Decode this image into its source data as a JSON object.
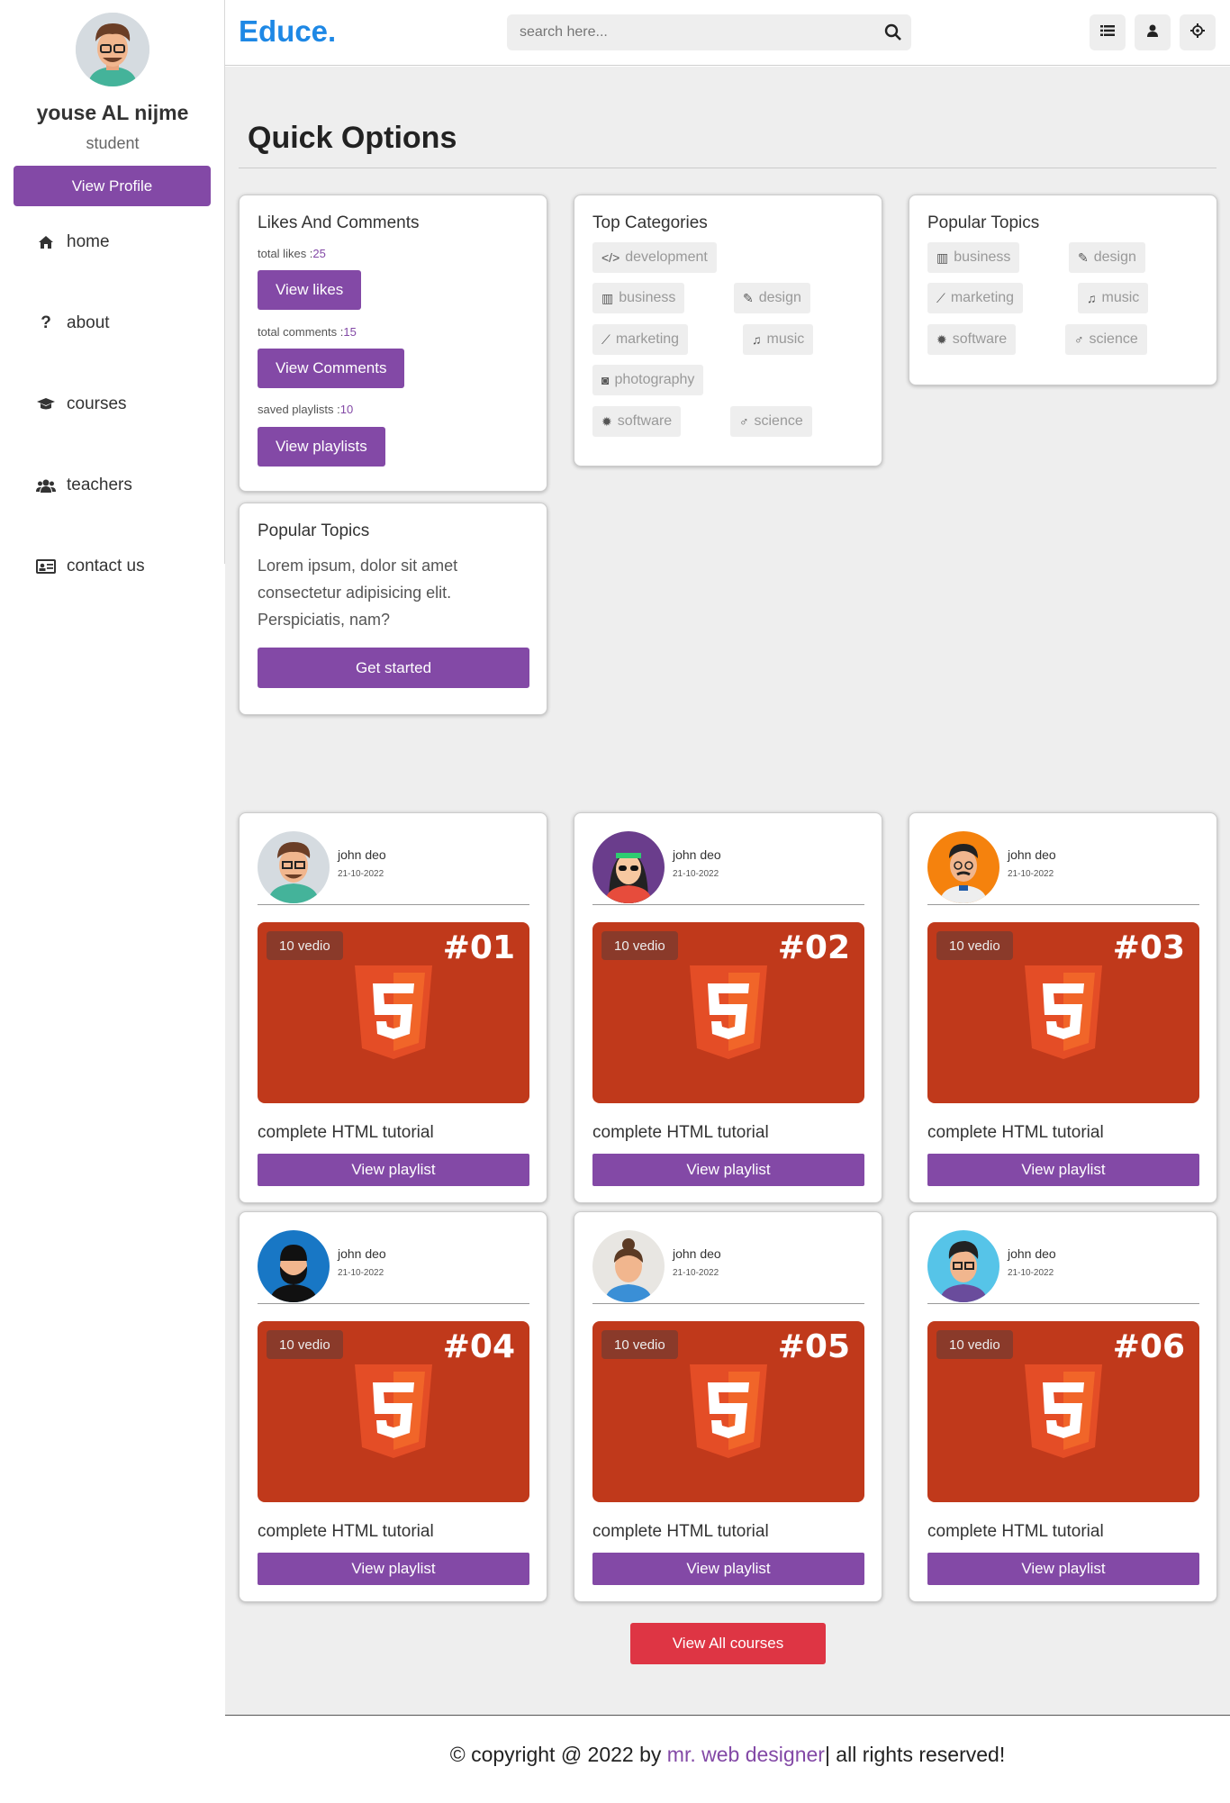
{
  "sidebar": {
    "user_name": "youse AL nijme",
    "role": "student",
    "view_profile": "View Profile",
    "items": [
      {
        "icon": "home-icon",
        "label": "home"
      },
      {
        "icon": "question-icon",
        "label": "about"
      },
      {
        "icon": "graduation-cap-icon",
        "label": "courses"
      },
      {
        "icon": "users-icon",
        "label": "teachers"
      },
      {
        "icon": "address-card-icon",
        "label": "contact us"
      }
    ]
  },
  "header": {
    "logo": "Educe.",
    "search_placeholder": "search here...",
    "icons": [
      "list-icon",
      "user-icon",
      "settings-icon"
    ]
  },
  "main": {
    "title": "Quick Options",
    "likes_box": {
      "title": "Likes And Comments",
      "likes_label": "total likes :",
      "likes": "25",
      "view_likes": "View likes",
      "comments_label": "total comments :",
      "comments": "15",
      "view_comments": "View Comments",
      "playlists_label": "saved playlists :",
      "playlists": "10",
      "view_playlists": "View playlists"
    },
    "top_categories": {
      "title": "Top Categories",
      "tags": [
        {
          "icon": "code-icon",
          "label": "development"
        },
        {
          "icon": "bar-chart-icon",
          "label": "business"
        },
        {
          "icon": "pencil-icon",
          "label": "design"
        },
        {
          "icon": "line-chart-icon",
          "label": "marketing"
        },
        {
          "icon": "music-icon",
          "label": "music"
        },
        {
          "icon": "camera-icon",
          "label": "photography"
        },
        {
          "icon": "gear-icon",
          "label": "software"
        },
        {
          "icon": "flask-icon",
          "label": "science"
        }
      ]
    },
    "popular_topics": {
      "title": "Popular Topics",
      "tags": [
        {
          "icon": "bar-chart-icon",
          "label": "business"
        },
        {
          "icon": "pencil-icon",
          "label": "design"
        },
        {
          "icon": "line-chart-icon",
          "label": "marketing"
        },
        {
          "icon": "music-icon",
          "label": "music"
        },
        {
          "icon": "gear-icon",
          "label": "software"
        },
        {
          "icon": "flask-icon",
          "label": "science"
        }
      ]
    },
    "intro_box": {
      "title": "Popular Topics",
      "text": "Lorem ipsum, dolor sit amet consectetur adipisicing elit. Perspiciatis, nam?",
      "button": "Get started"
    },
    "courses": [
      {
        "author": "john deo",
        "date": "21-10-2022",
        "count": "10 vedio",
        "number": "#01",
        "title": "complete HTML tutorial",
        "button": "View playlist"
      },
      {
        "author": "john deo",
        "date": "21-10-2022",
        "count": "10 vedio",
        "number": "#02",
        "title": "complete HTML tutorial",
        "button": "View playlist"
      },
      {
        "author": "john deo",
        "date": "21-10-2022",
        "count": "10 vedio",
        "number": "#03",
        "title": "complete HTML tutorial",
        "button": "View playlist"
      },
      {
        "author": "john deo",
        "date": "21-10-2022",
        "count": "10 vedio",
        "number": "#04",
        "title": "complete HTML tutorial",
        "button": "View playlist"
      },
      {
        "author": "john deo",
        "date": "21-10-2022",
        "count": "10 vedio",
        "number": "#05",
        "title": "complete HTML tutorial",
        "button": "View playlist"
      },
      {
        "author": "john deo",
        "date": "21-10-2022",
        "count": "10 vedio",
        "number": "#06",
        "title": "complete HTML tutorial",
        "button": "View playlist"
      }
    ],
    "view_all": "View All courses"
  },
  "footer": {
    "prefix": "© copyright @ 2022 by ",
    "link": "mr. web designer",
    "suffix": "| all rights reserved!"
  },
  "colors": {
    "accent": "#8349a6",
    "logo": "#1e88e5",
    "danger": "#de3544",
    "thumb": "#c0391b"
  }
}
